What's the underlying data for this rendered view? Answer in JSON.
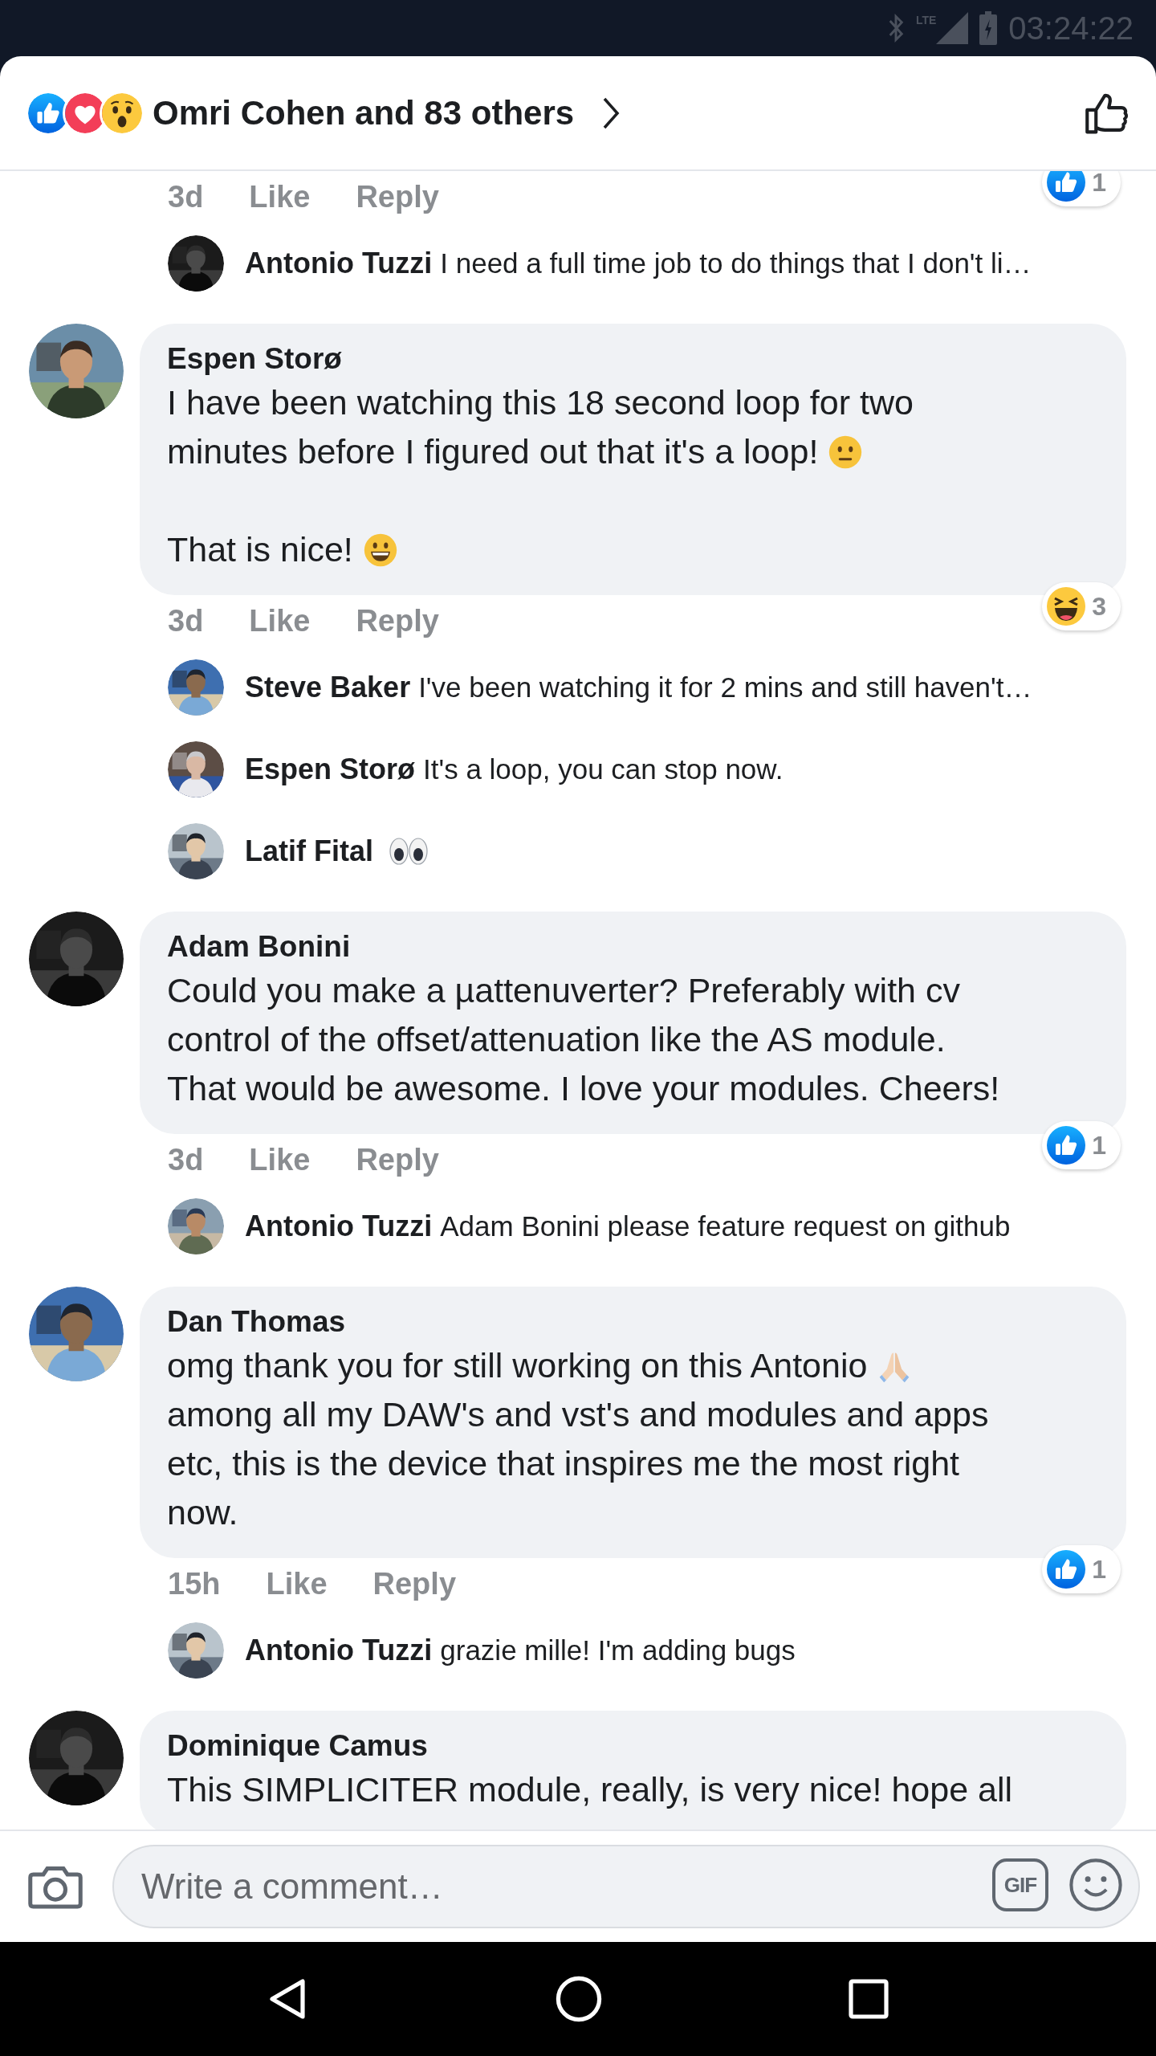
{
  "status_bar": {
    "network": "LTE",
    "time": "03:24:22"
  },
  "header": {
    "reactions": [
      {
        "kind": "like"
      },
      {
        "kind": "love"
      },
      {
        "kind": "wow"
      }
    ],
    "summary": "Omri Cohen and 83 others"
  },
  "thread": [
    {
      "kind": "meta",
      "time": "3d",
      "like": "Like",
      "reply": "Reply",
      "reaction": {
        "kind": "like",
        "count": "1"
      }
    },
    {
      "kind": "reply",
      "author": "Antonio Tuzzi",
      "text": "I need a full time job to do things that I don't li…"
    },
    {
      "kind": "comment",
      "author": "Espen Storø",
      "paragraphs": [
        {
          "lines": [
            {
              "text": "I have been watching this 18 second loop for two"
            },
            {
              "text": "minutes before I figured out that it's a loop!",
              "emoji": {
                "kind": "neutral"
              }
            }
          ]
        },
        {
          "lines": [
            {
              "text": "That is nice!",
              "emoji": {
                "kind": "grin"
              }
            }
          ]
        }
      ]
    },
    {
      "kind": "meta",
      "time": "3d",
      "like": "Like",
      "reply": "Reply",
      "reaction": {
        "kind": "haha",
        "count": "3"
      }
    },
    {
      "kind": "reply",
      "author": "Steve Baker",
      "text": "I've been watching it for 2 mins and still haven't…"
    },
    {
      "kind": "reply",
      "author": "Espen Storø",
      "text": "It's a loop, you can stop now."
    },
    {
      "kind": "reply",
      "author": "Latif Fital",
      "emoji": {
        "kind": "eyes"
      }
    },
    {
      "kind": "comment",
      "author": "Adam Bonini",
      "paragraphs": [
        {
          "lines": [
            {
              "text": "Could you make a µattenuverter? Preferably with cv"
            },
            {
              "text": "control of the offset/attenuation like the AS module."
            },
            {
              "text": "That would be awesome. I love your modules. Cheers!"
            }
          ]
        }
      ]
    },
    {
      "kind": "meta",
      "time": "3d",
      "like": "Like",
      "reply": "Reply",
      "reaction": {
        "kind": "like",
        "count": "1"
      }
    },
    {
      "kind": "reply",
      "author": "Antonio Tuzzi",
      "text": "Adam Bonini please feature request on github"
    },
    {
      "kind": "comment",
      "author": "Dan Thomas",
      "paragraphs": [
        {
          "lines": [
            {
              "text": "omg thank you for still working on this Antonio",
              "emoji": {
                "kind": "pray"
              }
            },
            {
              "text": "among all my DAW's and vst's and modules and apps"
            },
            {
              "text": "etc, this is the device that inspires me the most right"
            },
            {
              "text": "now."
            }
          ]
        }
      ]
    },
    {
      "kind": "meta",
      "time": "15h",
      "like": "Like",
      "reply": "Reply",
      "reaction": {
        "kind": "like",
        "count": "1"
      }
    },
    {
      "kind": "reply",
      "author": "Antonio Tuzzi",
      "text": "grazie mille! I'm adding bugs"
    },
    {
      "kind": "comment",
      "author": "Dominique Camus",
      "paragraphs": [
        {
          "lines": [
            {
              "text": "This SIMPLICITER module, really, is very nice! hope all"
            }
          ]
        }
      ]
    }
  ],
  "composer": {
    "placeholder": "Write a comment…",
    "gif": "GIF"
  }
}
